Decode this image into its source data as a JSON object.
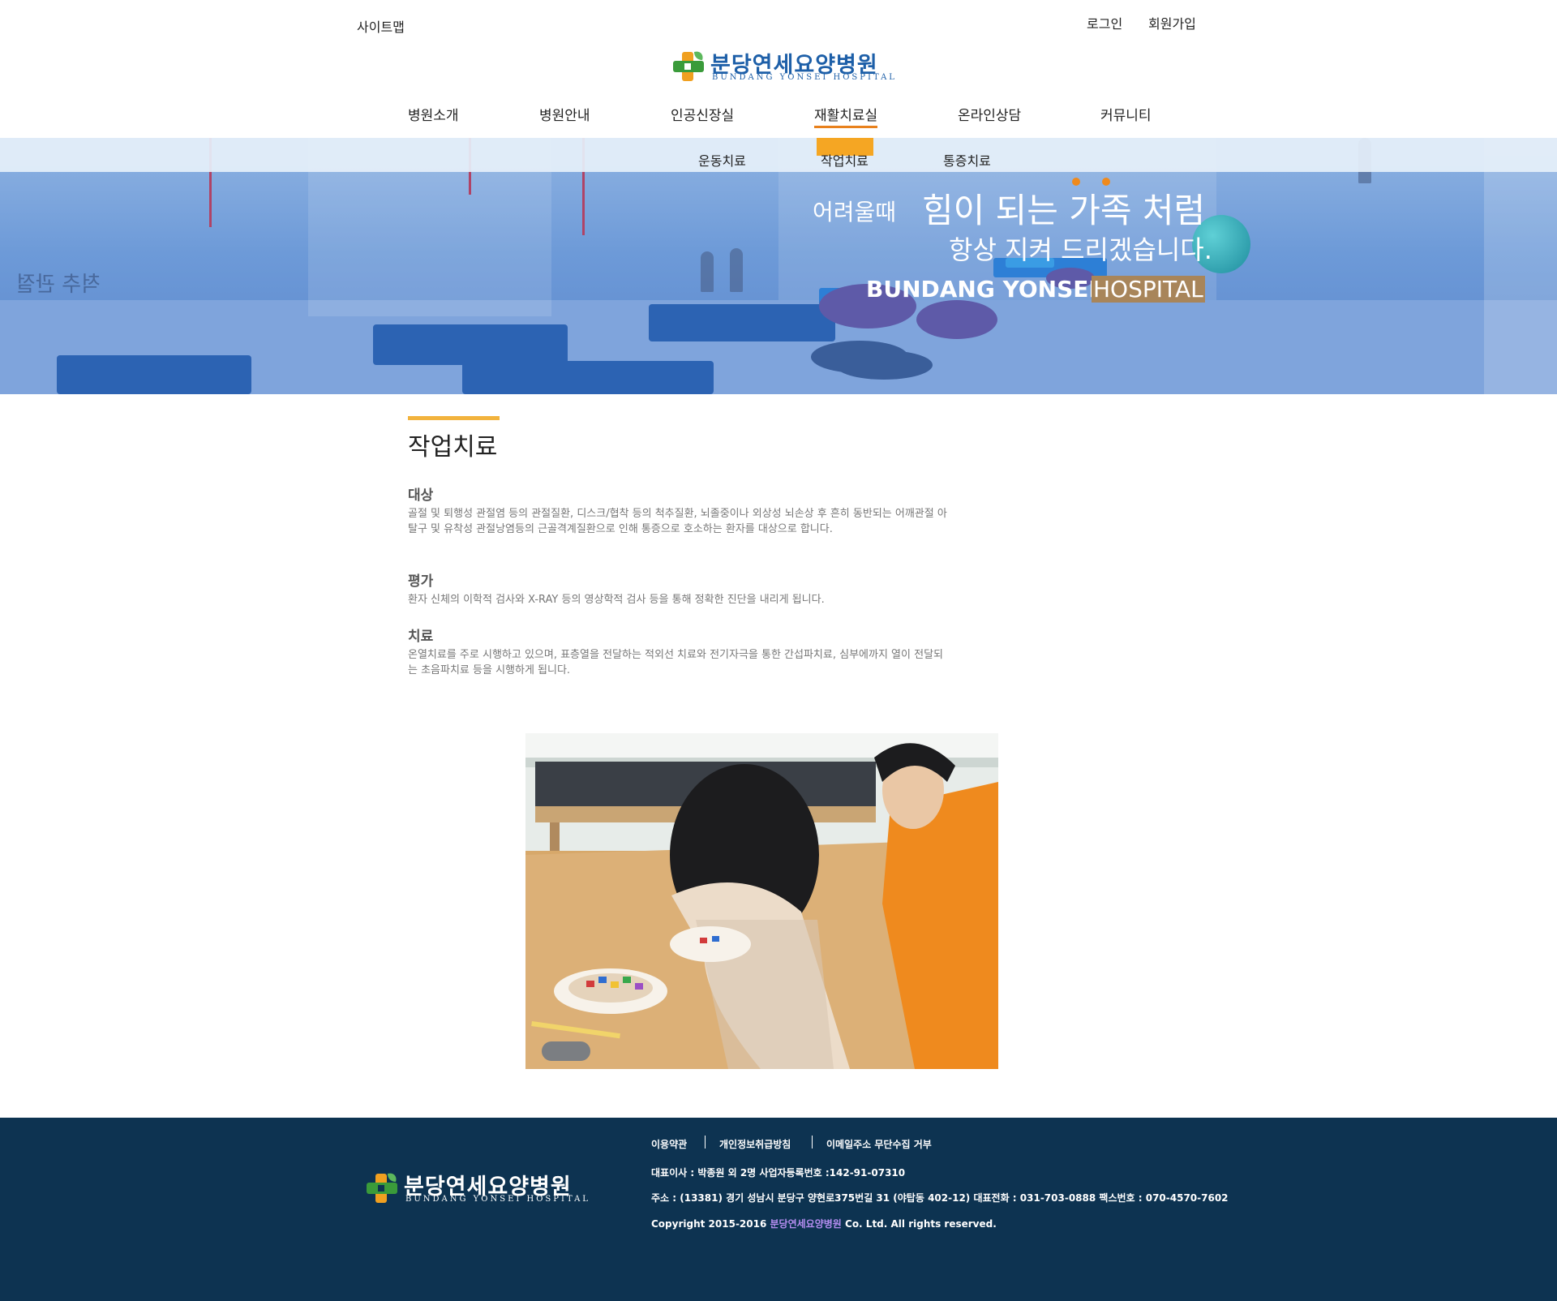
{
  "top_links": {
    "sitemap": "사이트맵",
    "login": "로그인",
    "signup": "회원가입"
  },
  "logo": {
    "name_ko": "분당연세요양병원",
    "name_en": "BUNDANG YONSEI HOSPITAL"
  },
  "nav": {
    "items": [
      "병원소개",
      "병원안내",
      "인공신장실",
      "재활치료실",
      "온라인상담",
      "커뮤니티"
    ],
    "active": "재활치료실"
  },
  "subnav": {
    "items": [
      "운동치료",
      "작업치료",
      "통증치료"
    ],
    "active": "작업치료"
  },
  "banner": {
    "line1_small": "어려울때",
    "line1_large": "힘이 되는 가족 처럼",
    "line2": "항상 지켜 드리겠습니다.",
    "en_bold": "BUNDANG YONSEI",
    "en_light": "HOSPITAL",
    "wall_text": "척추 관절"
  },
  "content": {
    "title": "작업치료",
    "sections": [
      {
        "heading": "대상",
        "text": "골절 및 퇴행성 관절염 등의 관절질환, 디스크/협착 등의 척추질환, 뇌졸중이나 외상성 뇌손상 후 흔히 동반되는 어깨관절 아탈구 및 유착성 관절낭염등의 근골격계질환으로 인해 통증으로 호소하는 환자를 대상으로 합니다."
      },
      {
        "heading": "평가",
        "text": "환자 신체의 이학적 검사와 X-RAY 등의 영상학적 검사 등을 통해 정확한 진단을 내리게 됩니다."
      },
      {
        "heading": "치료",
        "text": "온열치료를 주로 시행하고 있으며, 표층열을 전달하는 적외선 치료와 전기자극을 통한 간섭파치료, 심부에까지 열이 전달되는 초음파치료 등을 시행하게 됩니다."
      }
    ]
  },
  "footer": {
    "links": [
      "이용약관",
      "개인정보취급방침",
      "이메일주소 무단수집 거부"
    ],
    "ceo_line": "대표이사 : 박종원 외 2명  사업자등록번호 :142-91-07310",
    "address_line": "주소 : (13381) 경기 성남시 분당구 양현로375번길 31 (야탑동 402-12)  대표전화 : 031-703-0888  팩스번호 : 070-4570-7602",
    "copyright_prefix": "Copyright 2015-2016 ",
    "copyright_name": "분당연세요양병원",
    "copyright_suffix": " Co. Ltd. All rights reserved."
  },
  "colors": {
    "accent_orange": "#e8811c",
    "title_bar_yellow": "#f2b33d",
    "footer_bg": "#0d3351",
    "logo_blue": "#1d5fa8",
    "banner_blue": "#6d9ad8"
  },
  "icons": [
    "logo-cross-icon",
    "footer-logo-cross-icon"
  ]
}
